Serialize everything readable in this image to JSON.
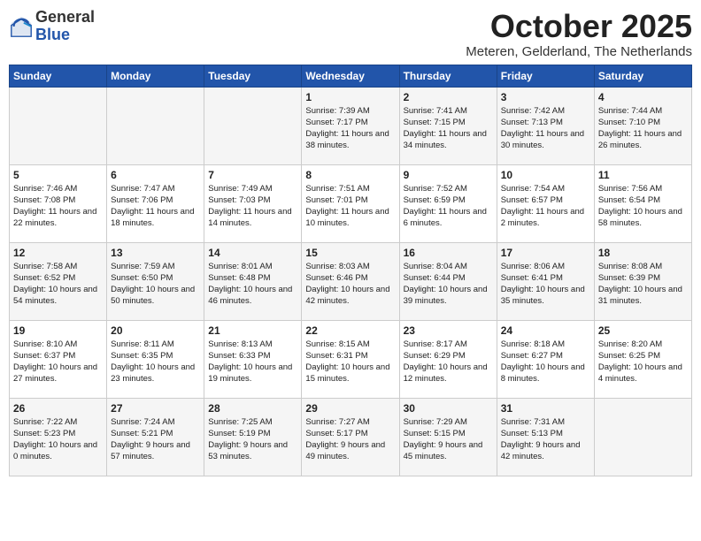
{
  "header": {
    "logo_general": "General",
    "logo_blue": "Blue",
    "month": "October 2025",
    "location": "Meteren, Gelderland, The Netherlands"
  },
  "weekdays": [
    "Sunday",
    "Monday",
    "Tuesday",
    "Wednesday",
    "Thursday",
    "Friday",
    "Saturday"
  ],
  "weeks": [
    [
      {
        "day": "",
        "info": ""
      },
      {
        "day": "",
        "info": ""
      },
      {
        "day": "",
        "info": ""
      },
      {
        "day": "1",
        "info": "Sunrise: 7:39 AM\nSunset: 7:17 PM\nDaylight: 11 hours\nand 38 minutes."
      },
      {
        "day": "2",
        "info": "Sunrise: 7:41 AM\nSunset: 7:15 PM\nDaylight: 11 hours\nand 34 minutes."
      },
      {
        "day": "3",
        "info": "Sunrise: 7:42 AM\nSunset: 7:13 PM\nDaylight: 11 hours\nand 30 minutes."
      },
      {
        "day": "4",
        "info": "Sunrise: 7:44 AM\nSunset: 7:10 PM\nDaylight: 11 hours\nand 26 minutes."
      }
    ],
    [
      {
        "day": "5",
        "info": "Sunrise: 7:46 AM\nSunset: 7:08 PM\nDaylight: 11 hours\nand 22 minutes."
      },
      {
        "day": "6",
        "info": "Sunrise: 7:47 AM\nSunset: 7:06 PM\nDaylight: 11 hours\nand 18 minutes."
      },
      {
        "day": "7",
        "info": "Sunrise: 7:49 AM\nSunset: 7:03 PM\nDaylight: 11 hours\nand 14 minutes."
      },
      {
        "day": "8",
        "info": "Sunrise: 7:51 AM\nSunset: 7:01 PM\nDaylight: 11 hours\nand 10 minutes."
      },
      {
        "day": "9",
        "info": "Sunrise: 7:52 AM\nSunset: 6:59 PM\nDaylight: 11 hours\nand 6 minutes."
      },
      {
        "day": "10",
        "info": "Sunrise: 7:54 AM\nSunset: 6:57 PM\nDaylight: 11 hours\nand 2 minutes."
      },
      {
        "day": "11",
        "info": "Sunrise: 7:56 AM\nSunset: 6:54 PM\nDaylight: 10 hours\nand 58 minutes."
      }
    ],
    [
      {
        "day": "12",
        "info": "Sunrise: 7:58 AM\nSunset: 6:52 PM\nDaylight: 10 hours\nand 54 minutes."
      },
      {
        "day": "13",
        "info": "Sunrise: 7:59 AM\nSunset: 6:50 PM\nDaylight: 10 hours\nand 50 minutes."
      },
      {
        "day": "14",
        "info": "Sunrise: 8:01 AM\nSunset: 6:48 PM\nDaylight: 10 hours\nand 46 minutes."
      },
      {
        "day": "15",
        "info": "Sunrise: 8:03 AM\nSunset: 6:46 PM\nDaylight: 10 hours\nand 42 minutes."
      },
      {
        "day": "16",
        "info": "Sunrise: 8:04 AM\nSunset: 6:44 PM\nDaylight: 10 hours\nand 39 minutes."
      },
      {
        "day": "17",
        "info": "Sunrise: 8:06 AM\nSunset: 6:41 PM\nDaylight: 10 hours\nand 35 minutes."
      },
      {
        "day": "18",
        "info": "Sunrise: 8:08 AM\nSunset: 6:39 PM\nDaylight: 10 hours\nand 31 minutes."
      }
    ],
    [
      {
        "day": "19",
        "info": "Sunrise: 8:10 AM\nSunset: 6:37 PM\nDaylight: 10 hours\nand 27 minutes."
      },
      {
        "day": "20",
        "info": "Sunrise: 8:11 AM\nSunset: 6:35 PM\nDaylight: 10 hours\nand 23 minutes."
      },
      {
        "day": "21",
        "info": "Sunrise: 8:13 AM\nSunset: 6:33 PM\nDaylight: 10 hours\nand 19 minutes."
      },
      {
        "day": "22",
        "info": "Sunrise: 8:15 AM\nSunset: 6:31 PM\nDaylight: 10 hours\nand 15 minutes."
      },
      {
        "day": "23",
        "info": "Sunrise: 8:17 AM\nSunset: 6:29 PM\nDaylight: 10 hours\nand 12 minutes."
      },
      {
        "day": "24",
        "info": "Sunrise: 8:18 AM\nSunset: 6:27 PM\nDaylight: 10 hours\nand 8 minutes."
      },
      {
        "day": "25",
        "info": "Sunrise: 8:20 AM\nSunset: 6:25 PM\nDaylight: 10 hours\nand 4 minutes."
      }
    ],
    [
      {
        "day": "26",
        "info": "Sunrise: 7:22 AM\nSunset: 5:23 PM\nDaylight: 10 hours\nand 0 minutes."
      },
      {
        "day": "27",
        "info": "Sunrise: 7:24 AM\nSunset: 5:21 PM\nDaylight: 9 hours\nand 57 minutes."
      },
      {
        "day": "28",
        "info": "Sunrise: 7:25 AM\nSunset: 5:19 PM\nDaylight: 9 hours\nand 53 minutes."
      },
      {
        "day": "29",
        "info": "Sunrise: 7:27 AM\nSunset: 5:17 PM\nDaylight: 9 hours\nand 49 minutes."
      },
      {
        "day": "30",
        "info": "Sunrise: 7:29 AM\nSunset: 5:15 PM\nDaylight: 9 hours\nand 45 minutes."
      },
      {
        "day": "31",
        "info": "Sunrise: 7:31 AM\nSunset: 5:13 PM\nDaylight: 9 hours\nand 42 minutes."
      },
      {
        "day": "",
        "info": ""
      }
    ]
  ]
}
